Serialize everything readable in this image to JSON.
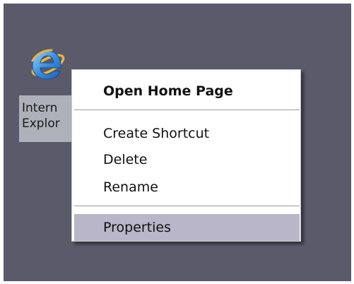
{
  "desktop": {
    "background_color": "#5b5a6b",
    "icons": [
      {
        "icon": "internet-explorer-icon",
        "label_line1": "Intern",
        "label_line2": "Explor"
      }
    ]
  },
  "context_menu": {
    "items": [
      {
        "label": "Open Home Page",
        "bold": true
      },
      {
        "label": "Create Shortcut"
      },
      {
        "label": "Delete"
      },
      {
        "label": "Rename"
      },
      {
        "label": "Properties",
        "highlighted": true
      }
    ],
    "highlight_color": "#b8b6c8"
  }
}
